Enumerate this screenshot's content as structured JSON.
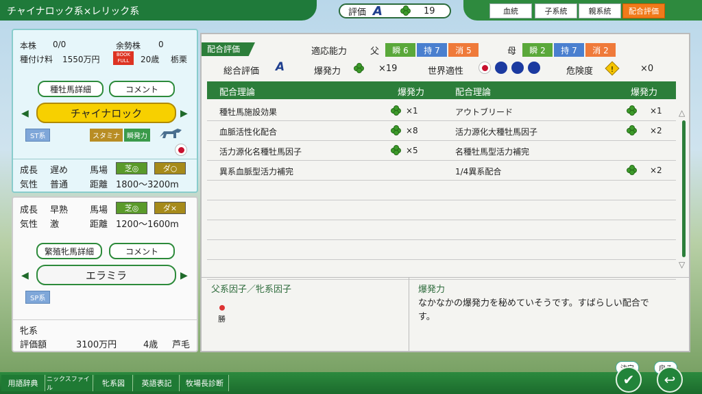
{
  "title": "チャイナロック系×レリック系",
  "rating": {
    "label": "評価",
    "grade": "A",
    "clover_count": "19"
  },
  "tabs": [
    "血統",
    "子系統",
    "親系統",
    "配合評価"
  ],
  "sire": {
    "headline_lines": [
      "本株",
      "0/0",
      "余勢株",
      "0"
    ],
    "fee_label": "種付け料",
    "fee": "1550万円",
    "book_badge": "BOOK FULL",
    "age": "20歳",
    "location": "栃栗",
    "detail_btn": "種牡馬詳細",
    "comment_btn": "コメント",
    "name": "チャイナロック",
    "type": "ST系",
    "tags": [
      "スタミナ",
      "瞬発力"
    ],
    "growth_label": "成長",
    "growth": "遅め",
    "track_label": "馬場",
    "turf": "芝◎",
    "dirt": "ダ○",
    "temper_label": "気性",
    "temper": "普通",
    "dist_label": "距離",
    "distance": "1800～3200m"
  },
  "dam": {
    "growth_label": "成長",
    "growth": "早熟",
    "track_label": "馬場",
    "turf": "芝◎",
    "dirt": "ダ×",
    "temper_label": "気性",
    "temper": "激",
    "dist_label": "距離",
    "distance": "1200～1600m",
    "detail_btn": "繁殖牝馬詳細",
    "comment_btn": "コメント",
    "name": "エラミラ",
    "type": "SP系",
    "line_label": "牝系",
    "value_label": "評価額",
    "value": "3100万円",
    "age": "4歳",
    "coat": "芦毛"
  },
  "eval": {
    "section": "配合評価",
    "aptitude": "適応能力",
    "father": "父",
    "mother": "母",
    "father_abil": [
      "瞬 6",
      "持 7",
      "消 5"
    ],
    "mother_abil": [
      "瞬 2",
      "持 7",
      "消 2"
    ],
    "overall_label": "総合評価",
    "overall_grade": "A",
    "burst_label": "爆発力",
    "burst_value": "×19",
    "world_label": "世界適性",
    "risk_label": "危険度",
    "risk_value": "×0"
  },
  "table": {
    "headers": [
      "配合理論",
      "爆発力",
      "配合理論",
      "爆発力"
    ],
    "rows": [
      {
        "left": "種牡馬施設効果",
        "left_val": "×1",
        "right": "アウトブリード",
        "right_val": "×1"
      },
      {
        "left": "血脈活性化配合",
        "left_val": "×8",
        "right": "活力源化大種牡馬因子",
        "right_val": "×2"
      },
      {
        "left": "活力源化名種牡馬因子",
        "left_val": "×5",
        "right": "名種牡馬型活力補完",
        "right_val": ""
      },
      {
        "left": "異系血脈型活力補完",
        "left_val": "",
        "right": "1/4異系配合",
        "right_val": "×2"
      }
    ]
  },
  "factor": {
    "label": "父系因子／牝系因子",
    "item": "勝"
  },
  "desc": {
    "title": "爆発力",
    "text": "なかなかの爆発力を秘めていそうです。すばらしい配合です。"
  },
  "bottom": [
    "用語辞典",
    "ニックスファイル",
    "牝系図",
    "英語表記",
    "牧場長診断"
  ],
  "confirm": "決定",
  "back": "戻る"
}
